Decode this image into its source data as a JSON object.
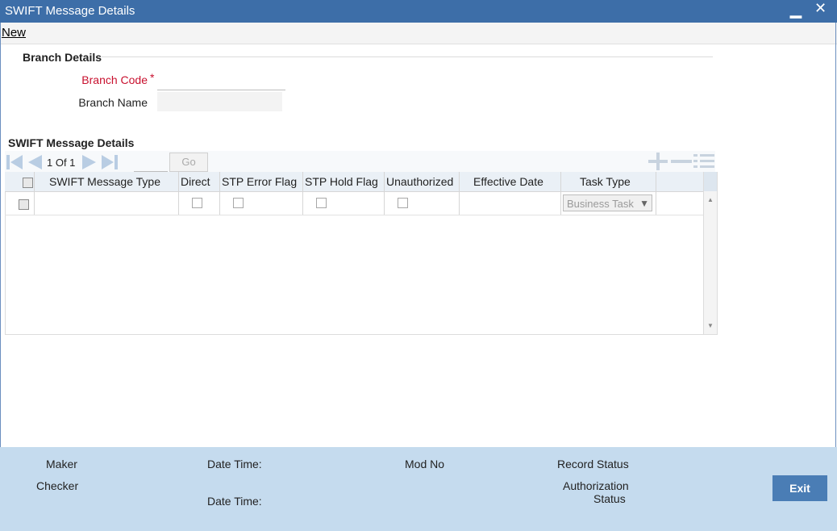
{
  "window": {
    "title": "SWIFT Message Details",
    "minimize": "▁",
    "close": "✕"
  },
  "toolbar": {
    "new_label": "New"
  },
  "branch": {
    "section_title": "Branch Details",
    "code_label": "Branch Code",
    "required_mark": "*",
    "code_value": "",
    "name_label": "Branch Name",
    "name_value": ""
  },
  "swift": {
    "section_title": "SWIFT Message Details",
    "pager": {
      "text": "1 Of 1",
      "go_label": "Go",
      "page_value": ""
    },
    "columns": [
      "SWIFT Message Type",
      "Direct",
      "STP Error Flag",
      "STP Hold Flag",
      "Unauthorized",
      "Effective Date",
      "Task Type"
    ],
    "rows": [
      {
        "message_type": "",
        "direct": false,
        "stp_error": false,
        "stp_hold": false,
        "unauthorized": false,
        "effective_date": "",
        "task_type": "Business Task"
      }
    ]
  },
  "footer": {
    "maker": "Maker",
    "checker": "Checker",
    "date_time_1": "Date Time:",
    "date_time_2": "Date Time:",
    "mod_no": "Mod No",
    "record_status": "Record Status",
    "auth_status_1": "Authorization",
    "auth_status_2": "Status",
    "exit_label": "Exit"
  },
  "colors": {
    "titlebar": "#3d6ea8",
    "footer": "#c5dbee",
    "required": "#c8102e",
    "exit_button": "#4a7db5"
  }
}
